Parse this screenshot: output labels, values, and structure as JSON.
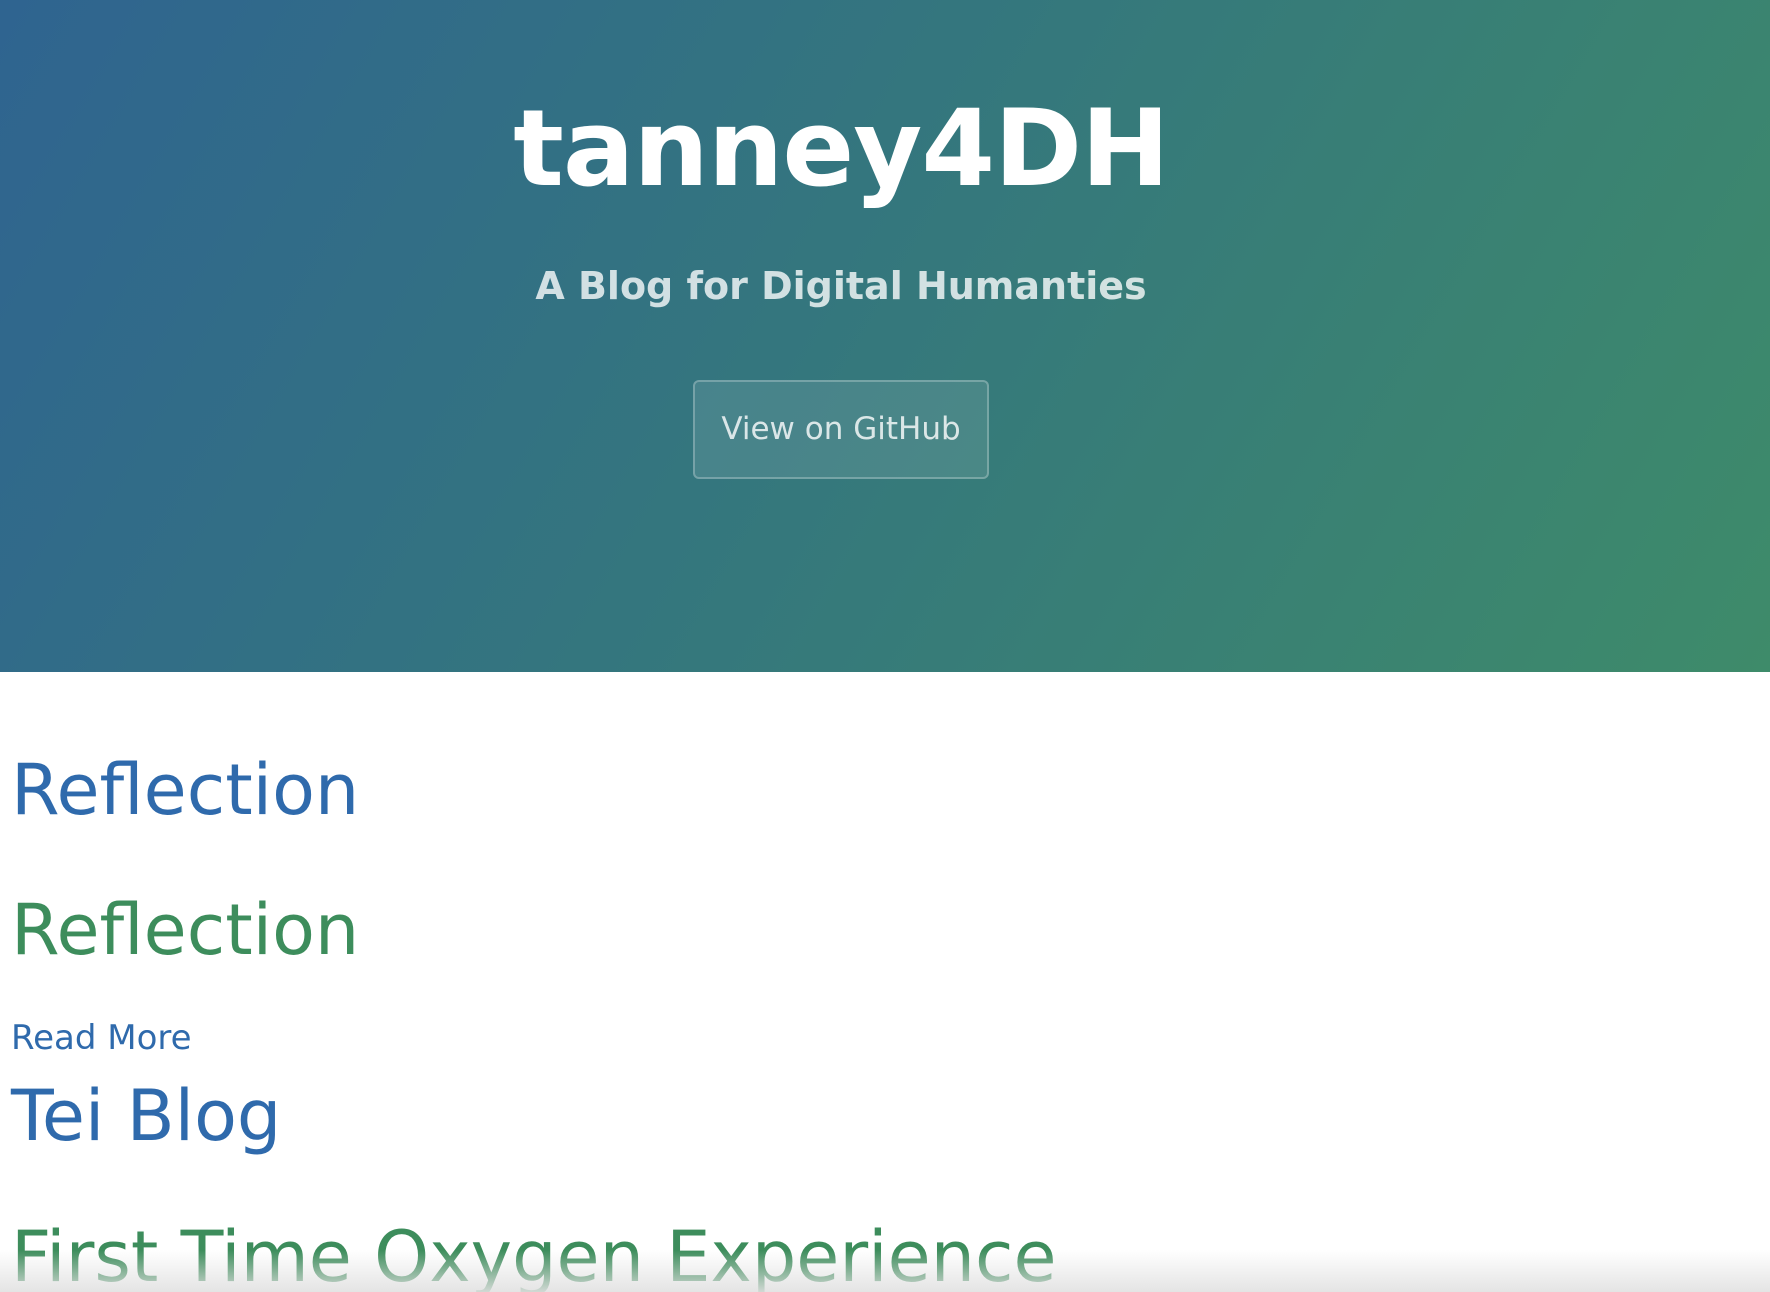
{
  "header": {
    "title": "tanney4DH",
    "tagline": "A Blog for Digital Humanties",
    "github_button_label": "View on GitHub",
    "gradient_colors": [
      "#2f6490",
      "#3e8b6a"
    ]
  },
  "posts": [
    {
      "title": "Reflection",
      "heading": "Reflection",
      "read_more_label": "Read More"
    },
    {
      "title": "Tei Blog",
      "heading": "First Time Oxygen Experience"
    }
  ],
  "colors": {
    "link": "#2f6aac",
    "heading": "#3d8d5c"
  }
}
